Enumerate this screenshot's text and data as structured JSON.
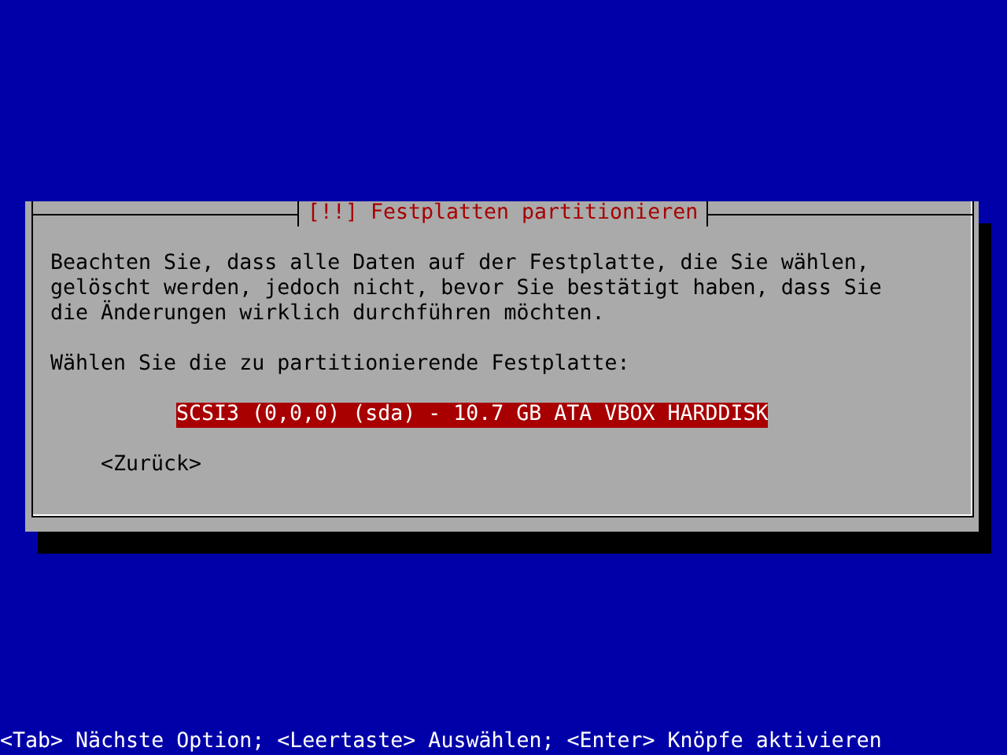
{
  "dialog": {
    "title": "[!!] Festplatten partitionieren",
    "message": "Beachten Sie, dass alle Daten auf der Festplatte, die Sie wählen, gelöscht werden, jedoch nicht, bevor Sie bestätigt haben, dass Sie die Änderungen wirklich durchführen möchten.",
    "prompt": "Wählen Sie die zu partitionierende Festplatte:",
    "options": [
      {
        "label": "SCSI3 (0,0,0) (sda) - 10.7 GB ATA VBOX HARDDISK",
        "selected": true
      }
    ],
    "buttons": [
      {
        "label": "<Zurück>"
      }
    ]
  },
  "hint": "<Tab> Nächste Option; <Leertaste> Auswählen; <Enter> Knöpfe aktivieren"
}
